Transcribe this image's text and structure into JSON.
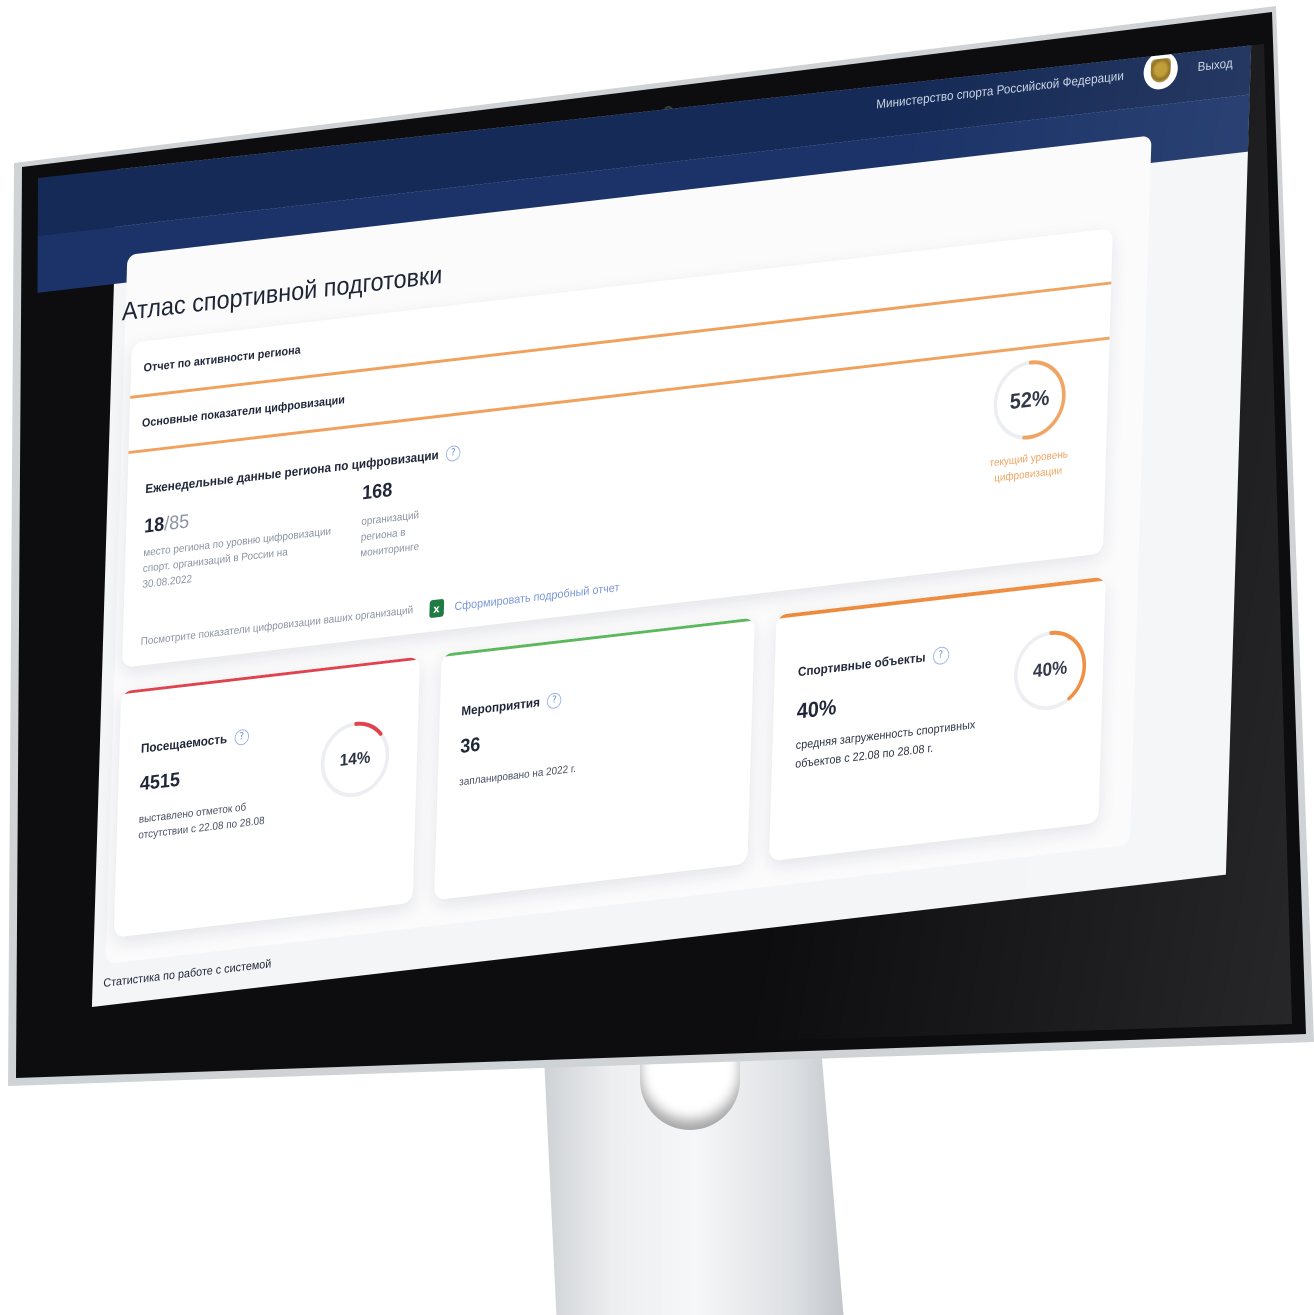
{
  "header": {
    "ministry": "Министерство спорта Российской Федерации",
    "logout": "Выход",
    "emblem_icon": "coat-of-arms-icon",
    "bg_color": "#152a56"
  },
  "page": {
    "title": "Атлас спортивной подготовки"
  },
  "region_report": {
    "section_title": "Отчет по активности региона",
    "subtitle": "Основные показатели цифровизации",
    "weekly_title": "Еженедельные данные региона по цифровизации",
    "rank_value": "18",
    "rank_total": "/85",
    "rank_desc": "место региона по уровню цифровизации спорт. организаций в России на 30.08.2022",
    "orgs_value": "168",
    "orgs_desc": "организаций региона в мониторинге",
    "view_text": "Посмотрите показатели цифровизации ваших организаций",
    "report_link": "Сформировать подробный отчет",
    "gauge_label": "52%",
    "gauge_value": 52,
    "gauge_caption": "текущий уровень цифровизации",
    "accent": "#f0a15c"
  },
  "cards": {
    "attendance": {
      "title": "Посещаемость",
      "value": "4515",
      "desc": "выставлено отметок об отсутствии с 22.08 по 28.08",
      "gauge_label": "14%",
      "gauge_value": 14,
      "accent": "#e0434e"
    },
    "events": {
      "title": "Мероприятия",
      "value": "36",
      "desc": "запланировано на 2022 г.",
      "accent": "#5cb85c"
    },
    "facilities": {
      "title": "Спортивные объекты",
      "value": "40%",
      "desc": "средняя загруженность спортивных объектов с 22.08 по 28.08 г.",
      "gauge_label": "40%",
      "gauge_value": 40,
      "accent": "#ee8a3c"
    }
  },
  "footer": {
    "stats_title": "Статистика по работе с системой"
  }
}
